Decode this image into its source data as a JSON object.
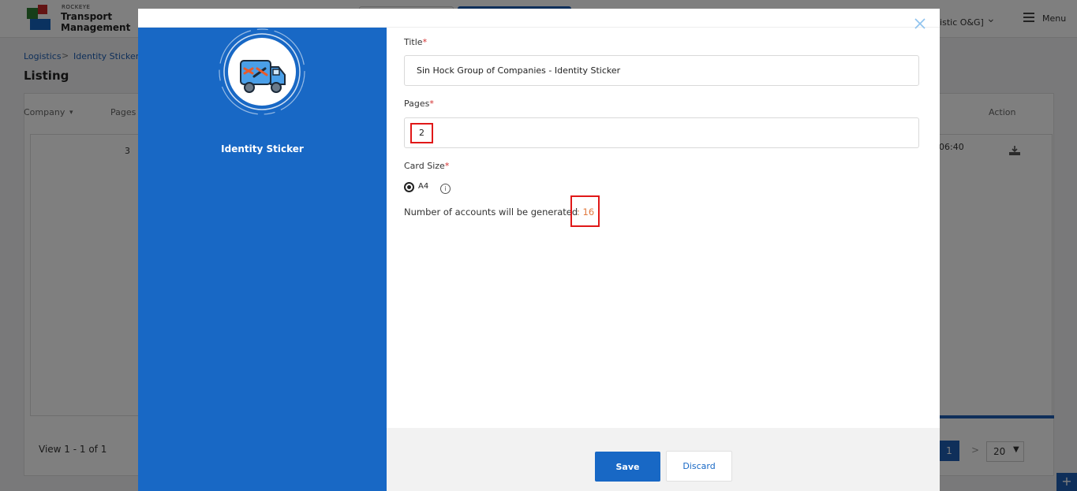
{
  "app": {
    "brand_small": "ROCKEYE",
    "brand_line1": "Transport",
    "brand_line2": "Management",
    "org": "listic O&G]",
    "menu_label": "Menu"
  },
  "breadcrumb": [
    "Logistics",
    "Identity Sticker"
  ],
  "page_title": "Listing",
  "table": {
    "headers": [
      "Company",
      "Pages",
      "Action"
    ],
    "row": {
      "pages": "3",
      "time": "06:40"
    }
  },
  "pagination": {
    "view_count": "View 1 - 1 of 1",
    "current_page": "1",
    "page_size": "20"
  },
  "modal": {
    "side_title": "Identity Sticker",
    "title_label": "Title",
    "title_value": "Sin Hock Group of Companies - Identity Sticker",
    "pages_label": "Pages",
    "pages_value": "2",
    "card_size_label": "Card Size",
    "card_size_option": "A4",
    "count_label": "Number of accounts will be generated",
    "count_value": ": 16",
    "required_mark": "*",
    "save_label": "Save",
    "discard_label": "Discard"
  },
  "colors": {
    "primary": "#1868c5",
    "highlight": "#e01818",
    "count_accent": "#e27a3f"
  },
  "icons": [
    "truck-wrench-icon",
    "close-icon",
    "info-icon",
    "download-icon",
    "menu-icon",
    "plus-icon"
  ]
}
